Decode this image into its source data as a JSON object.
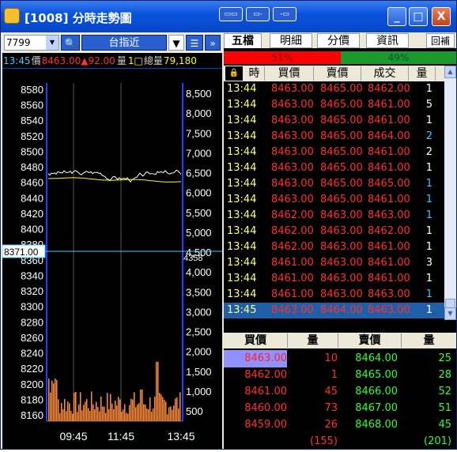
{
  "window": {
    "title": "[1008] 分時走勢圖",
    "title_icon": "app-icon",
    "toolbar_buttons": [
      "layout-icon",
      "window-icon",
      "dock-icon"
    ],
    "controls": {
      "minimize": "_",
      "maximize": "□",
      "close": "X"
    }
  },
  "left": {
    "symbol": "7799",
    "search_icon": "🔍",
    "index_label": "台指近",
    "down_icon": "▼",
    "list_icon": "☰",
    "more_icon": "»",
    "quote": {
      "time": "13:45",
      "price_label": "價",
      "price": "8463.00",
      "change": "▲92.00",
      "vol_label": "量",
      "vol": "1",
      "box": "□",
      "total_label": "總量",
      "total": "79,180"
    },
    "price_axis": [
      "8580",
      "8560",
      "8540",
      "8520",
      "8500",
      "8480",
      "8460",
      "8440",
      "8420",
      "8400",
      "8380",
      "8360",
      "8340",
      "8320",
      "8300",
      "8280",
      "8260",
      "8240",
      "8220",
      "8200",
      "8180",
      "8160"
    ],
    "vol_axis": [
      "8,500",
      "8,000",
      "7,500",
      "7,000",
      "6,500",
      "6,000",
      "5,500",
      "5,000",
      "4,500",
      "4,000",
      "3,500",
      "3,000",
      "2,500",
      "2,000",
      "1,500",
      "1,000",
      "500"
    ],
    "ref_price": "8371.00",
    "ref_vol": "4358",
    "time_axis": [
      "09:45",
      "11:45",
      "13:45"
    ],
    "colors": {
      "price_line": "#ffffff",
      "avg_line": "#ffff00",
      "volume": "#ff8c3c",
      "axis": "#2040ff",
      "ref": "#40c8ff"
    }
  },
  "right": {
    "tabs": [
      "五檔",
      "明細",
      "分價",
      "資訊",
      "回補"
    ],
    "buy_pct": "51%",
    "sell_pct": "49%",
    "headers": [
      "時",
      "買價",
      "賣價",
      "成交",
      "量"
    ],
    "lock_icon": "🔒",
    "ticks": [
      [
        "13:44",
        "8463.00",
        "8465.00",
        "8462.00",
        "1"
      ],
      [
        "13:44",
        "8463.00",
        "8465.00",
        "8461.00",
        "5"
      ],
      [
        "13:44",
        "8463.00",
        "8465.00",
        "8461.00",
        "1"
      ],
      [
        "13:44",
        "8463.00",
        "8465.00",
        "8464.00",
        "2"
      ],
      [
        "13:44",
        "8463.00",
        "8465.00",
        "8461.00",
        "2"
      ],
      [
        "13:44",
        "8463.00",
        "8465.00",
        "8461.00",
        "1"
      ],
      [
        "13:44",
        "8463.00",
        "8465.00",
        "8465.00",
        "1"
      ],
      [
        "13:44",
        "8463.00",
        "8465.00",
        "8461.00",
        "1"
      ],
      [
        "13:44",
        "8462.00",
        "8463.00",
        "8463.00",
        "1"
      ],
      [
        "13:44",
        "8462.00",
        "8463.00",
        "8462.00",
        "1"
      ],
      [
        "13:44",
        "8462.00",
        "8463.00",
        "8461.00",
        "1"
      ],
      [
        "13:44",
        "8461.00",
        "8463.00",
        "8461.00",
        "3"
      ],
      [
        "13:44",
        "8461.00",
        "8463.00",
        "8461.00",
        "1"
      ],
      [
        "13:44",
        "8461.00",
        "8463.00",
        "8463.00",
        "1"
      ],
      [
        "13:45",
        "8463.00",
        "8464.00",
        "8463.00",
        "1"
      ]
    ],
    "tick_vol_colors": [
      "#ffffff",
      "#ffffff",
      "#ffffff",
      "#40c8ff",
      "#ffffff",
      "#ffffff",
      "#40c8ff",
      "#40c8ff",
      "#40c8ff",
      "#ffffff",
      "#ffffff",
      "#ffffff",
      "#ffffff",
      "#40c8ff",
      "#ffffff"
    ],
    "book_headers": [
      "買價",
      "量",
      "賣價",
      "量"
    ],
    "book": [
      [
        "8463.00",
        "10",
        "8464.00",
        "25"
      ],
      [
        "8462.00",
        "1",
        "8465.00",
        "28"
      ],
      [
        "8461.00",
        "45",
        "8466.00",
        "52"
      ],
      [
        "8460.00",
        "73",
        "8467.00",
        "51"
      ],
      [
        "8459.00",
        "26",
        "8468.00",
        "45"
      ]
    ],
    "buy_total": "(155)",
    "sell_total": "(201)"
  }
}
